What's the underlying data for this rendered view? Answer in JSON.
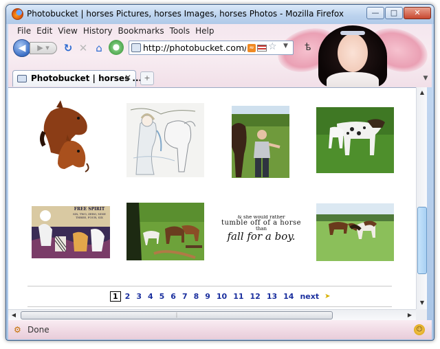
{
  "window": {
    "title": "Photobucket | horses Pictures, horses Images, horses Photos - Mozilla Firefox",
    "minimize": "—",
    "maximize": "□",
    "close": "✕"
  },
  "menu": [
    "File",
    "Edit",
    "View",
    "History",
    "Bookmarks",
    "Tools",
    "Help"
  ],
  "toolbar": {
    "url": "http://photobucket.com/image"
  },
  "tabs": [
    {
      "title": "Photobucket | horses ..."
    }
  ],
  "page": {
    "quote": {
      "line1": "& she would rather",
      "line2": "tumble off of a horse",
      "line3": "than",
      "line4": "fall for a boy."
    },
    "poster": {
      "title": "FREE SPIRIT",
      "line1": "SIX, TWO, ZERO, NINE",
      "line2": "THREE, FOUR, SIX"
    },
    "pagination": {
      "current": "1",
      "pages": [
        "2",
        "3",
        "4",
        "5",
        "6",
        "7",
        "8",
        "9",
        "10",
        "11",
        "12",
        "13",
        "14"
      ],
      "next": "next"
    }
  },
  "status": {
    "text": "Done"
  },
  "colors": {
    "link": "#1a2f9e",
    "accent": "#3b6fc5"
  },
  "icons": {
    "back": "back-arrow-icon",
    "forward": "forward-arrow-icon",
    "reload": "reload-icon",
    "stop": "stop-icon",
    "home": "home-icon",
    "rss": "rss-icon",
    "star": "bookmark-star-icon"
  }
}
